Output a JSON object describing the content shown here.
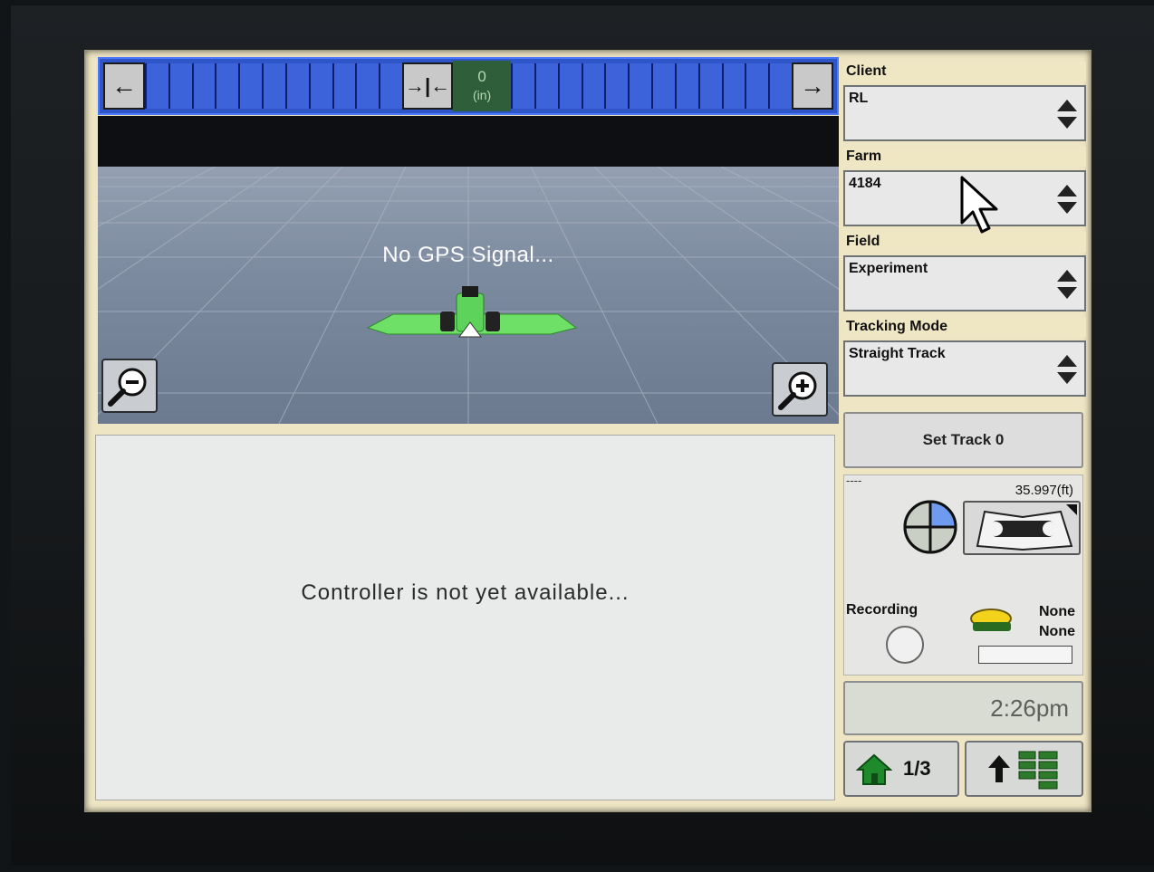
{
  "lightbar": {
    "left_arrow": "←",
    "right_arrow": "→",
    "center_value": "0",
    "center_unit": "(in)",
    "center_icon": "→|←"
  },
  "map": {
    "gps_status": "No GPS Signal..."
  },
  "controller": {
    "message": "Controller is not yet available..."
  },
  "sidebar": {
    "client": {
      "label": "Client",
      "value": "RL"
    },
    "farm": {
      "label": "Farm",
      "value": "4184"
    },
    "field": {
      "label": "Field",
      "value": "Experiment"
    },
    "tracking_mode": {
      "label": "Tracking Mode",
      "value": "Straight Track"
    },
    "set_track_button": "Set Track 0",
    "dashes": "----",
    "distance": "35.997(ft)",
    "recording_label": "Recording",
    "receiver_line1": "None",
    "receiver_line2": "None",
    "time": "2:26pm",
    "page_indicator": "1/3"
  },
  "colors": {
    "lightbar_blue": "#2f56c9",
    "tractor_green": "#5ed35b",
    "screen_beige": "#eee5c4"
  },
  "icons": [
    "zoom-out-icon",
    "zoom-in-icon",
    "spinner-icon",
    "crosshair-quadrant-icon",
    "wrench-book-icon",
    "gps-receiver-icon",
    "home-icon",
    "up-arrow-icon",
    "layout-grid-icon",
    "mouse-cursor-icon"
  ]
}
